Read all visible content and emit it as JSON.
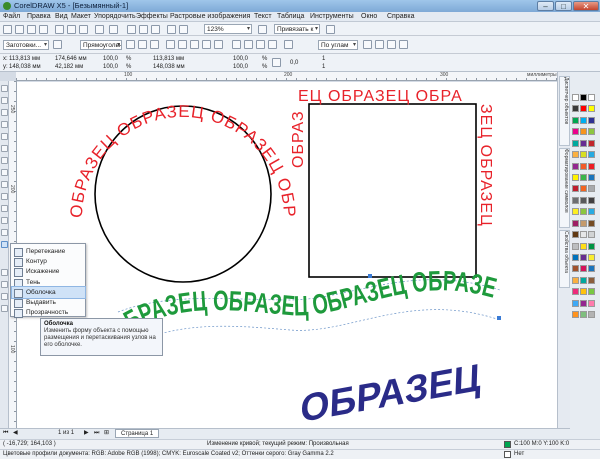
{
  "titlebar": {
    "title": "CorelDRAW X5 - [Безымянный-1]"
  },
  "menu": [
    "Файл",
    "Правка",
    "Вид",
    "Макет",
    "Упорядочить",
    "Эффекты",
    "Растровые изображения",
    "Текст",
    "Таблица",
    "Инструменты",
    "Окно",
    "Справка"
  ],
  "toolbar": {
    "launcher": "Заготовки...",
    "preset": "Прямоугольн...",
    "zoom": "123%",
    "snap": "Привязать к",
    "mode": "По углам"
  },
  "propbar": {
    "x": "113,813 мм",
    "y": "148,038 мм",
    "w": "174,646 мм",
    "h": "42,182 мм",
    "sx": "100,0",
    "sy": "100,0",
    "pct": "%",
    "x2": "113,813 мм",
    "y2": "148,038 мм",
    "a1": "100,0",
    "a2": "100,0",
    "a3": "0,0",
    "b1": "1",
    "b2": "1"
  },
  "ruler": {
    "top_labels": [
      "100",
      "200",
      "300"
    ],
    "units": "миллиметры",
    "left_labels": [
      "250",
      "200",
      "150",
      "100"
    ]
  },
  "canvas": {
    "circle_text": "ОБРАЗЕЦ ОБРАЗЕЦ ОБРАЗЕЦ ОБРАЗЕЦ",
    "square_text_top": "ЕЦ ОБРАЗЕЦ ОБРА",
    "square_text_left": "ОБРАЗ",
    "square_text_right": "ЗЕЦ ОБРАЗЕЦ",
    "wave_text": "ОБРАЗЕЦ ОБРАЗЕЦ ОБРАЗЕЦ ОБРАЗЕЦ",
    "italic_text": "ОБРАЗЕЦ",
    "colors": {
      "red": "#e8222a",
      "green": "#1e9a3c",
      "navy": "#2a2b88"
    }
  },
  "flyout": {
    "items": [
      {
        "label": "Перетекание",
        "selected": false
      },
      {
        "label": "Контур",
        "selected": false
      },
      {
        "label": "Искажение",
        "selected": false
      },
      {
        "label": "Тень",
        "selected": false
      },
      {
        "label": "Оболочка",
        "selected": true
      },
      {
        "label": "Выдавить",
        "selected": false
      },
      {
        "label": "Прозрачность",
        "selected": false
      }
    ]
  },
  "tooltip": {
    "title": "Оболочка",
    "text": "Изменить форму объекта с помощью размещения и перетаскивания узлов на его оболочке."
  },
  "dockers": [
    "Диспетчер объектов",
    "Форматирование символов",
    "Свойства объекта"
  ],
  "pagenav": {
    "counter": "1 из 1",
    "page_tab": "Страница 1"
  },
  "status": {
    "coords": "( -16,729; 164,103 )",
    "message": "Изменение кривой; текущий режим: Произвольная",
    "fill_info": "C:100 M:0 Y:100 K:0",
    "outline_info": "Нет",
    "profiles": "Цветовые профили документа: RGB: Adobe RGB (1998); CMYK: Euroscale Coated v2; Оттенки серого: Gray Gamma 2.2"
  },
  "palette": [
    "#ffffff",
    "#000000",
    "#ffffff",
    "#3a3a3a",
    "#ff0000",
    "#ffff00",
    "#00a651",
    "#00aeef",
    "#2e3192",
    "#ec008c",
    "#f7941d",
    "#8dc63f",
    "#00a99d",
    "#662d91",
    "#c1272d",
    "#fbb040",
    "#d7df23",
    "#27aae1",
    "#92278f",
    "#f15a29",
    "#ed1c24",
    "#fff200",
    "#39b54a",
    "#1b75bc",
    "#be1e2d",
    "#f26522",
    "#a7a9ac",
    "#6d6e71",
    "#58595b",
    "#414042",
    "#fcee21",
    "#8cc63f",
    "#29abe2",
    "#9e1f63",
    "#c49a6c",
    "#754c24",
    "#603913",
    "#e6e7e8",
    "#d1d3d4",
    "#bcbec0",
    "#ffde17",
    "#009444",
    "#0072bc",
    "#652d90",
    "#f9ed32",
    "#a0522d",
    "#d4145a",
    "#1c75bc",
    "#faaf40",
    "#00a79d",
    "#8b5e3c",
    "#ee2a7b",
    "#ffc20e",
    "#7ac943",
    "#3fa9f5",
    "#93278f",
    "#ff7bac",
    "#ff931e",
    "#7fbf7f",
    "#b3b3b3"
  ]
}
